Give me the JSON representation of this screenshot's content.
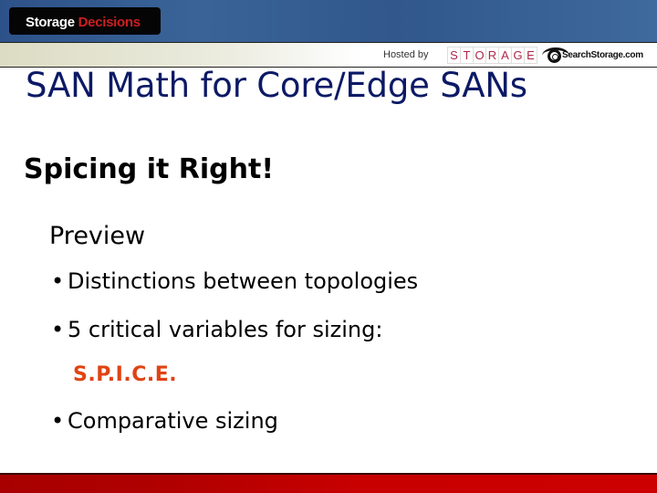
{
  "header": {
    "brand_part1": "Storage",
    "brand_part2": "Decisions",
    "hosted_by": "Hosted by",
    "storage_logo_letters": [
      "S",
      "T",
      "O",
      "R",
      "A",
      "G",
      "E"
    ],
    "search_logo_text": "SearchStorage.com"
  },
  "slide": {
    "title": "SAN Math for Core/Edge SANs",
    "subtitle": "Spicing it Right!",
    "section": "Preview",
    "bullets": [
      "Distinctions between topologies",
      "5 critical variables for sizing:",
      "Comparative sizing"
    ],
    "bullet_glyph": "•",
    "acronym": "S.P.I.C.E."
  },
  "colors": {
    "header_blue": "#31578c",
    "title_navy": "#0c1a66",
    "acronym_orange": "#e04314",
    "footer_red": "#c80000",
    "brand_red": "#cc1f1f"
  }
}
